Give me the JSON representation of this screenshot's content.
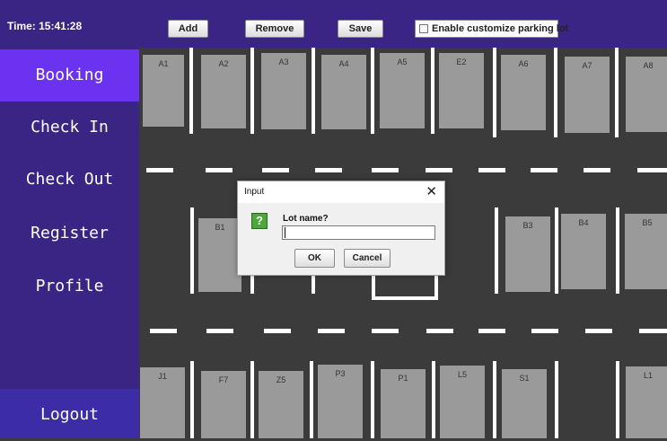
{
  "header": {
    "clock": "Time: 15:41:28",
    "add_label": "Add",
    "remove_label": "Remove",
    "save_label": "Save",
    "customize_label": "Enable customize parking lot",
    "customize_checked": false
  },
  "sidebar": {
    "items": [
      {
        "label": "Booking",
        "active": true
      },
      {
        "label": "Check In",
        "active": false
      },
      {
        "label": "Check Out",
        "active": false
      },
      {
        "label": "Register",
        "active": false
      },
      {
        "label": "Profile",
        "active": false
      }
    ],
    "logout_label": "Logout"
  },
  "lot": {
    "top_row": [
      "A1",
      "A2",
      "A3",
      "A4",
      "A5",
      "E2",
      "A6",
      "A7",
      "A8"
    ],
    "middle_row": [
      "B1",
      "B3",
      "B4",
      "B5"
    ],
    "bottom_row": [
      "J1",
      "F7",
      "Z5",
      "P3",
      "P1",
      "L5",
      "S1",
      "L1"
    ]
  },
  "dialog": {
    "title": "Input",
    "close_symbol": "✕",
    "icon_symbol": "?",
    "prompt": "Lot name?",
    "input_value": "",
    "ok_label": "OK",
    "cancel_label": "Cancel"
  },
  "colors": {
    "sidebar_bg": "#3a2585",
    "sidebar_active": "#6b33f0",
    "lot_bg": "#3b3b3b",
    "slot": "#9a9a9a"
  }
}
